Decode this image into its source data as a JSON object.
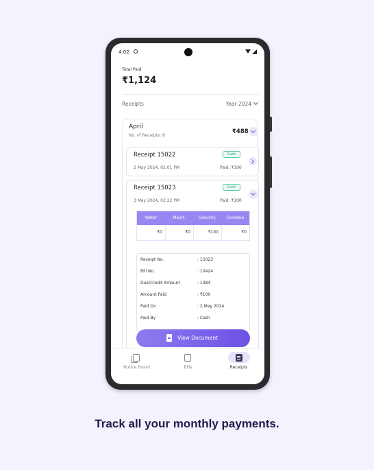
{
  "status_bar": {
    "time": "4:02"
  },
  "summary": {
    "total_paid_label": "Total Paid",
    "total_paid_value": "₹1,124"
  },
  "receipts_section": {
    "label": "Receipts",
    "year_filter": "Year 2024"
  },
  "month": {
    "name": "April",
    "count_label": "No. of Receipts: 8",
    "total": "₹488"
  },
  "receipts": [
    {
      "title": "Receipt 15022",
      "date": "2 May 2024, 02:01 PM",
      "mode": "Cash",
      "paid": "Paid: ₹100"
    },
    {
      "title": "Receipt 15023",
      "date": "3 May 2024, 02:22 PM",
      "mode": "Cash",
      "paid": "Paid: ₹100"
    }
  ],
  "charges": {
    "headers": [
      "Water",
      "Maint.",
      "Security",
      "Overdue"
    ],
    "values": [
      "₹0",
      "₹0",
      "₹100",
      "₹0"
    ]
  },
  "details": [
    {
      "key": "Receipt No.",
      "value": ": 15023"
    },
    {
      "key": "Bill No.",
      "value": ": 10424"
    },
    {
      "key": "Due/Credit Amount",
      "value": ": 1384"
    },
    {
      "key": "Amount Paid",
      "value": ": ₹100"
    },
    {
      "key": "Paid On",
      "value": ": 2 May 2024"
    },
    {
      "key": "Paid By",
      "value": ": Cash"
    }
  ],
  "view_document_label": "View Document",
  "nav": [
    {
      "label": "Notice Board",
      "icon": "notice-board-icon",
      "active": false
    },
    {
      "label": "Bills",
      "icon": "bills-icon",
      "active": false
    },
    {
      "label": "Receipts",
      "icon": "receipts-icon",
      "active": true
    }
  ],
  "caption": "Track all your monthly payments.",
  "colors": {
    "accent": "#7e66ec",
    "cash_badge": "#23a67a",
    "background": "#f4f2fd"
  }
}
